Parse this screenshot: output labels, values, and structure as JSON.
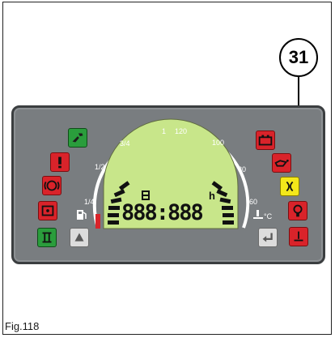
{
  "callout": {
    "number": "31"
  },
  "gauge": {
    "left_scale": [
      "1/4",
      "1/2",
      "3/4",
      "1"
    ],
    "right_scale": [
      "60",
      "80",
      "100",
      "120"
    ],
    "temp_unit": "°C"
  },
  "display": {
    "digits": "888:888",
    "hour_symbol": "h"
  },
  "figure_label": "Fig.118",
  "icons": {
    "left": [
      "wrench-icon",
      "exclamation-icon",
      "brake-icon",
      "battery-charge-icon",
      "parking-brake-icon"
    ],
    "right": [
      "battery-icon",
      "oil-pressure-icon",
      "glow-plug-icon",
      "filter-icon",
      "coolant-temp-icon"
    ],
    "buttons": [
      "up-arrow-button",
      "enter-button"
    ]
  },
  "colors": {
    "red": "#d9232a",
    "green": "#2a9d3c",
    "yellow": "#f4e81a",
    "panel": "#797d80",
    "lcd": "#c8e68a"
  }
}
